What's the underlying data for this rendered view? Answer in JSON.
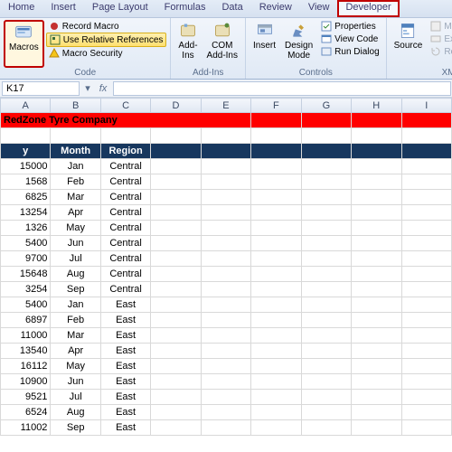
{
  "ribbon": {
    "tabs": [
      "Home",
      "Insert",
      "Page Layout",
      "Formulas",
      "Data",
      "Review",
      "View",
      "Developer"
    ],
    "code": {
      "macros": "Macros",
      "record": "Record Macro",
      "relative": "Use Relative References",
      "security": "Macro Security",
      "group": "Code"
    },
    "addins": {
      "addins": "Add-Ins",
      "com": "COM\nAdd-Ins",
      "group": "Add-Ins"
    },
    "controls": {
      "insert": "Insert",
      "design": "Design\nMode",
      "props": "Properties",
      "viewcode": "View Code",
      "rundlg": "Run Dialog",
      "group": "Controls"
    },
    "xml": {
      "source": "Source",
      "mapprops": "Map Properties",
      "expansion": "Expansion Pack",
      "refresh": "Refresh Data",
      "group": "XML"
    }
  },
  "namebox": "K17",
  "columns": [
    "A",
    "B",
    "C",
    "D",
    "E",
    "F",
    "G",
    "H",
    "I"
  ],
  "title": "RedZone Tyre Company",
  "headers": {
    "a": "y",
    "b": "Month",
    "c": "Region"
  },
  "rows": [
    {
      "v": 15000,
      "m": "Jan",
      "r": "Central"
    },
    {
      "v": 1568,
      "m": "Feb",
      "r": "Central"
    },
    {
      "v": 6825,
      "m": "Mar",
      "r": "Central"
    },
    {
      "v": 13254,
      "m": "Apr",
      "r": "Central"
    },
    {
      "v": 1326,
      "m": "May",
      "r": "Central"
    },
    {
      "v": 5400,
      "m": "Jun",
      "r": "Central"
    },
    {
      "v": 9700,
      "m": "Jul",
      "r": "Central"
    },
    {
      "v": 15648,
      "m": "Aug",
      "r": "Central"
    },
    {
      "v": 3254,
      "m": "Sep",
      "r": "Central"
    },
    {
      "v": 5400,
      "m": "Jan",
      "r": "East"
    },
    {
      "v": 6897,
      "m": "Feb",
      "r": "East"
    },
    {
      "v": 11000,
      "m": "Mar",
      "r": "East"
    },
    {
      "v": 13540,
      "m": "Apr",
      "r": "East"
    },
    {
      "v": 16112,
      "m": "May",
      "r": "East"
    },
    {
      "v": 10900,
      "m": "Jun",
      "r": "East"
    },
    {
      "v": 9521,
      "m": "Jul",
      "r": "East"
    },
    {
      "v": 6524,
      "m": "Aug",
      "r": "East"
    },
    {
      "v": 11002,
      "m": "Sep",
      "r": "East"
    }
  ]
}
